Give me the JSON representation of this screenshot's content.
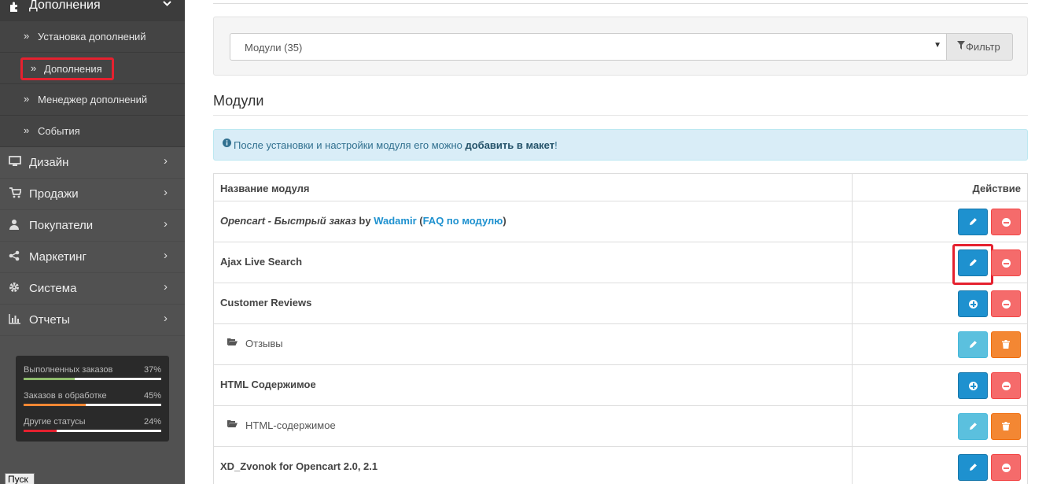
{
  "sidebar": {
    "section": {
      "label": "Дополнения",
      "icon": "puzzle-icon"
    },
    "subitems": [
      {
        "label": "Установка дополнений"
      },
      {
        "label": "Дополнения",
        "highlighted": true
      },
      {
        "label": "Менеджер дополнений"
      },
      {
        "label": "События"
      }
    ],
    "menu": [
      {
        "label": "Дизайн",
        "icon": "desktop-icon"
      },
      {
        "label": "Продажи",
        "icon": "cart-icon"
      },
      {
        "label": "Покупатели",
        "icon": "user-icon"
      },
      {
        "label": "Маркетинг",
        "icon": "share-icon"
      },
      {
        "label": "Система",
        "icon": "gear-icon"
      },
      {
        "label": "Отчеты",
        "icon": "bar-chart-icon"
      }
    ],
    "stats": [
      {
        "label": "Выполненных заказов",
        "percent": "37%",
        "value": 37,
        "color": "#8fbb6c"
      },
      {
        "label": "Заказов в обработке",
        "percent": "45%",
        "value": 45,
        "color": "#f38733"
      },
      {
        "label": "Другие статусы",
        "percent": "24%",
        "value": 24,
        "color": "#e5212f"
      }
    ]
  },
  "taskbar": {
    "start_label": "Пуск"
  },
  "filter": {
    "selected": "Модули (35)",
    "button_label": "Фильтр"
  },
  "section_title": "Модули",
  "alert": {
    "text_before": "После установки и настройки модуля его можно ",
    "text_bold": "добавить в макет",
    "text_after": "!"
  },
  "table": {
    "headers": {
      "name": "Название модуля",
      "action": "Действие"
    },
    "rows": [
      {
        "name_italic": "Opencart - Быстрый заказ",
        "by": " by ",
        "author": "Wadamir",
        "open": " (",
        "faq": "FAQ по модулю",
        "close": ")",
        "actions": [
          "edit",
          "uninstall"
        ]
      },
      {
        "name": "Ajax Live Search",
        "actions": [
          "edit",
          "uninstall"
        ],
        "highlighted": true
      },
      {
        "name": "Customer Reviews",
        "actions": [
          "install",
          "uninstall"
        ]
      },
      {
        "sub_name": "Отзывы",
        "actions": [
          "edit",
          "delete"
        ]
      },
      {
        "name": "HTML Содержимое",
        "actions": [
          "install",
          "uninstall"
        ]
      },
      {
        "sub_name": "HTML-содержимое",
        "actions": [
          "edit",
          "delete"
        ]
      },
      {
        "name": "XD_Zvonok for Opencart 2.0, 2.1",
        "actions": [
          "edit",
          "uninstall"
        ]
      }
    ]
  }
}
